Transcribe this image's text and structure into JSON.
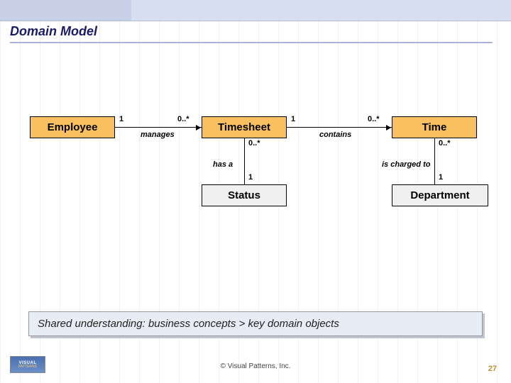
{
  "title": "Domain Model",
  "classes": {
    "employee": "Employee",
    "timesheet": "Timesheet",
    "time": "Time",
    "status": "Status",
    "department": "Department"
  },
  "associations": {
    "manages": {
      "label": "manages",
      "left_mult": "1",
      "right_mult": "0..*"
    },
    "contains": {
      "label": "contains",
      "left_mult": "1",
      "right_mult": "0..*"
    },
    "has_a": {
      "label": "has a",
      "top_mult": "0..*",
      "bottom_mult": "1"
    },
    "charged_to": {
      "label": "is charged to",
      "top_mult": "0..*",
      "bottom_mult": "1"
    }
  },
  "footer_caption": "Shared understanding: business concepts > key domain objects",
  "copyright": "© Visual Patterns, Inc.",
  "page_number": "27",
  "logo": {
    "line1": "VISUAL",
    "line2": "PATTERNS"
  }
}
